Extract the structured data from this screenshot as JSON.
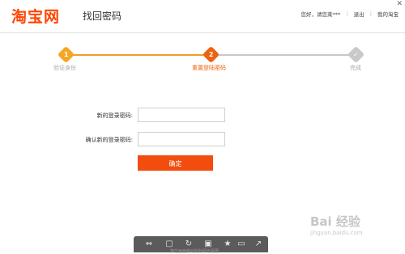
{
  "header": {
    "logo": "淘宝网",
    "title": "找回密码",
    "greeting": "您好，请您莱***",
    "logout": "退出",
    "my_taobao": "我的淘宝"
  },
  "steps": [
    {
      "number": "1",
      "label": "验证身份",
      "state": "done"
    },
    {
      "number": "2",
      "label": "重置登陆密码",
      "state": "current"
    },
    {
      "number": "✓",
      "label": "完成",
      "state": "todo"
    }
  ],
  "form": {
    "new_password_label": "新的登录密码:",
    "confirm_password_label": "确认新的登录密码:",
    "submit_label": "确定"
  },
  "toolbar": {
    "caption": "按住画面移动鼠标即可看图"
  },
  "watermark": {
    "logo": "Bai 经验",
    "sub": "jingyan.baidu.com"
  },
  "colors": {
    "brand": "#ff4400",
    "step_done": "#f5a623",
    "step_current": "#ee6210",
    "button": "#f34c0f"
  }
}
